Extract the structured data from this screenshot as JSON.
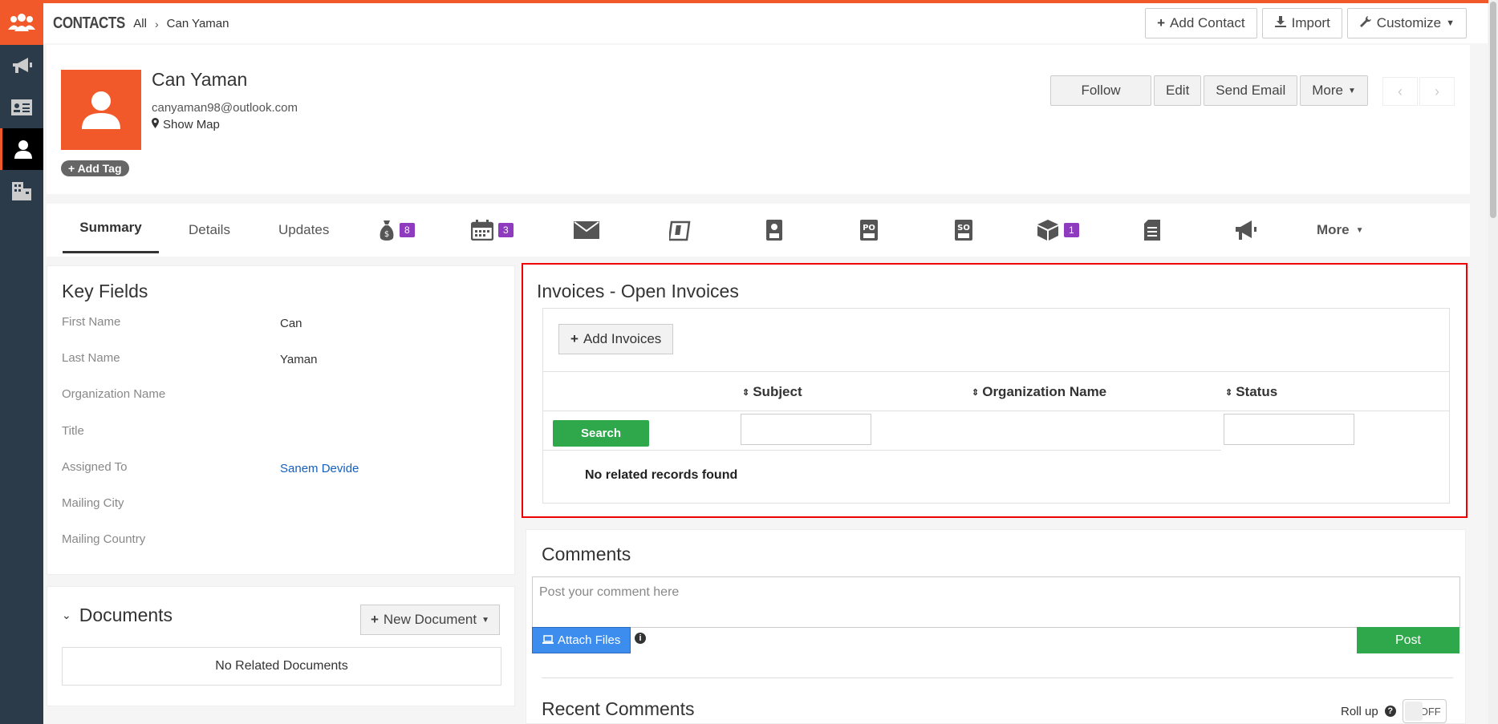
{
  "topbar": {
    "module": "CONTACTS",
    "crumb_all": "All",
    "crumb_record": "Can Yaman",
    "add_contact": "Add Contact",
    "import": "Import",
    "customize": "Customize"
  },
  "header": {
    "name": "Can Yaman",
    "email": "canyaman98@outlook.com",
    "show_map": "Show Map",
    "add_tag": "Add Tag",
    "buttons": {
      "follow": "Follow",
      "edit": "Edit",
      "send_email": "Send Email",
      "more": "More"
    }
  },
  "tabs": {
    "summary": "Summary",
    "details": "Details",
    "updates": "Updates",
    "deals_count": "8",
    "calendar_count": "3",
    "products_count": "1",
    "more": "More"
  },
  "key_fields": {
    "title": "Key Fields",
    "rows": [
      {
        "label": "First Name",
        "value": "Can"
      },
      {
        "label": "Last Name",
        "value": "Yaman"
      },
      {
        "label": "Organization Name",
        "value": ""
      },
      {
        "label": "Title",
        "value": ""
      },
      {
        "label": "Assigned To",
        "value": "Sanem Devide"
      },
      {
        "label": "Mailing City",
        "value": ""
      },
      {
        "label": "Mailing Country",
        "value": ""
      }
    ]
  },
  "documents": {
    "title": "Documents",
    "new_document": "New Document",
    "empty": "No Related Documents"
  },
  "invoices": {
    "title": "Invoices - Open Invoices",
    "add": "Add Invoices",
    "columns": [
      "Subject",
      "Organization Name",
      "Status"
    ],
    "search": "Search",
    "subject_filter": "",
    "status_filter": "",
    "empty": "No related records found"
  },
  "comments": {
    "title": "Comments",
    "placeholder": "Post your comment here",
    "attach": "Attach Files",
    "post": "Post",
    "recent": "Recent Comments",
    "rollup": "Roll up",
    "toggle": "OFF"
  },
  "colors": {
    "brand": "#f1592a",
    "sidebar": "#2c3b49",
    "success": "#2ea84b",
    "badge": "#8e3bbf",
    "highlight": "#ee0000"
  }
}
